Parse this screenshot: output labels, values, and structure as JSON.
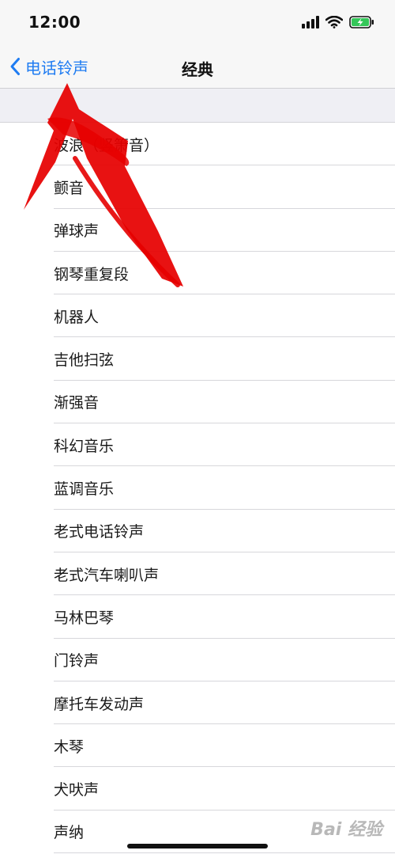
{
  "status_bar": {
    "time": "12:00",
    "icons": [
      "signal-icon",
      "wifi-icon",
      "battery-charging-icon"
    ],
    "battery_color": "#34c759"
  },
  "nav": {
    "back_label": "电话铃声",
    "title": "经典",
    "accent_color": "#1f7cf2"
  },
  "ringtones": [
    "波浪（竖箫音）",
    "颤音",
    "弹球声",
    "钢琴重复段",
    "机器人",
    "吉他扫弦",
    "渐强音",
    "科幻音乐",
    "蓝调音乐",
    "老式电话铃声",
    "老式汽车喇叭声",
    "马林巴琴",
    "门铃声",
    "摩托车发动声",
    "木琴",
    "犬吠声",
    "声纳"
  ],
  "watermark": {
    "text": "Bai 经验",
    "annotation_color": "#e60000"
  }
}
